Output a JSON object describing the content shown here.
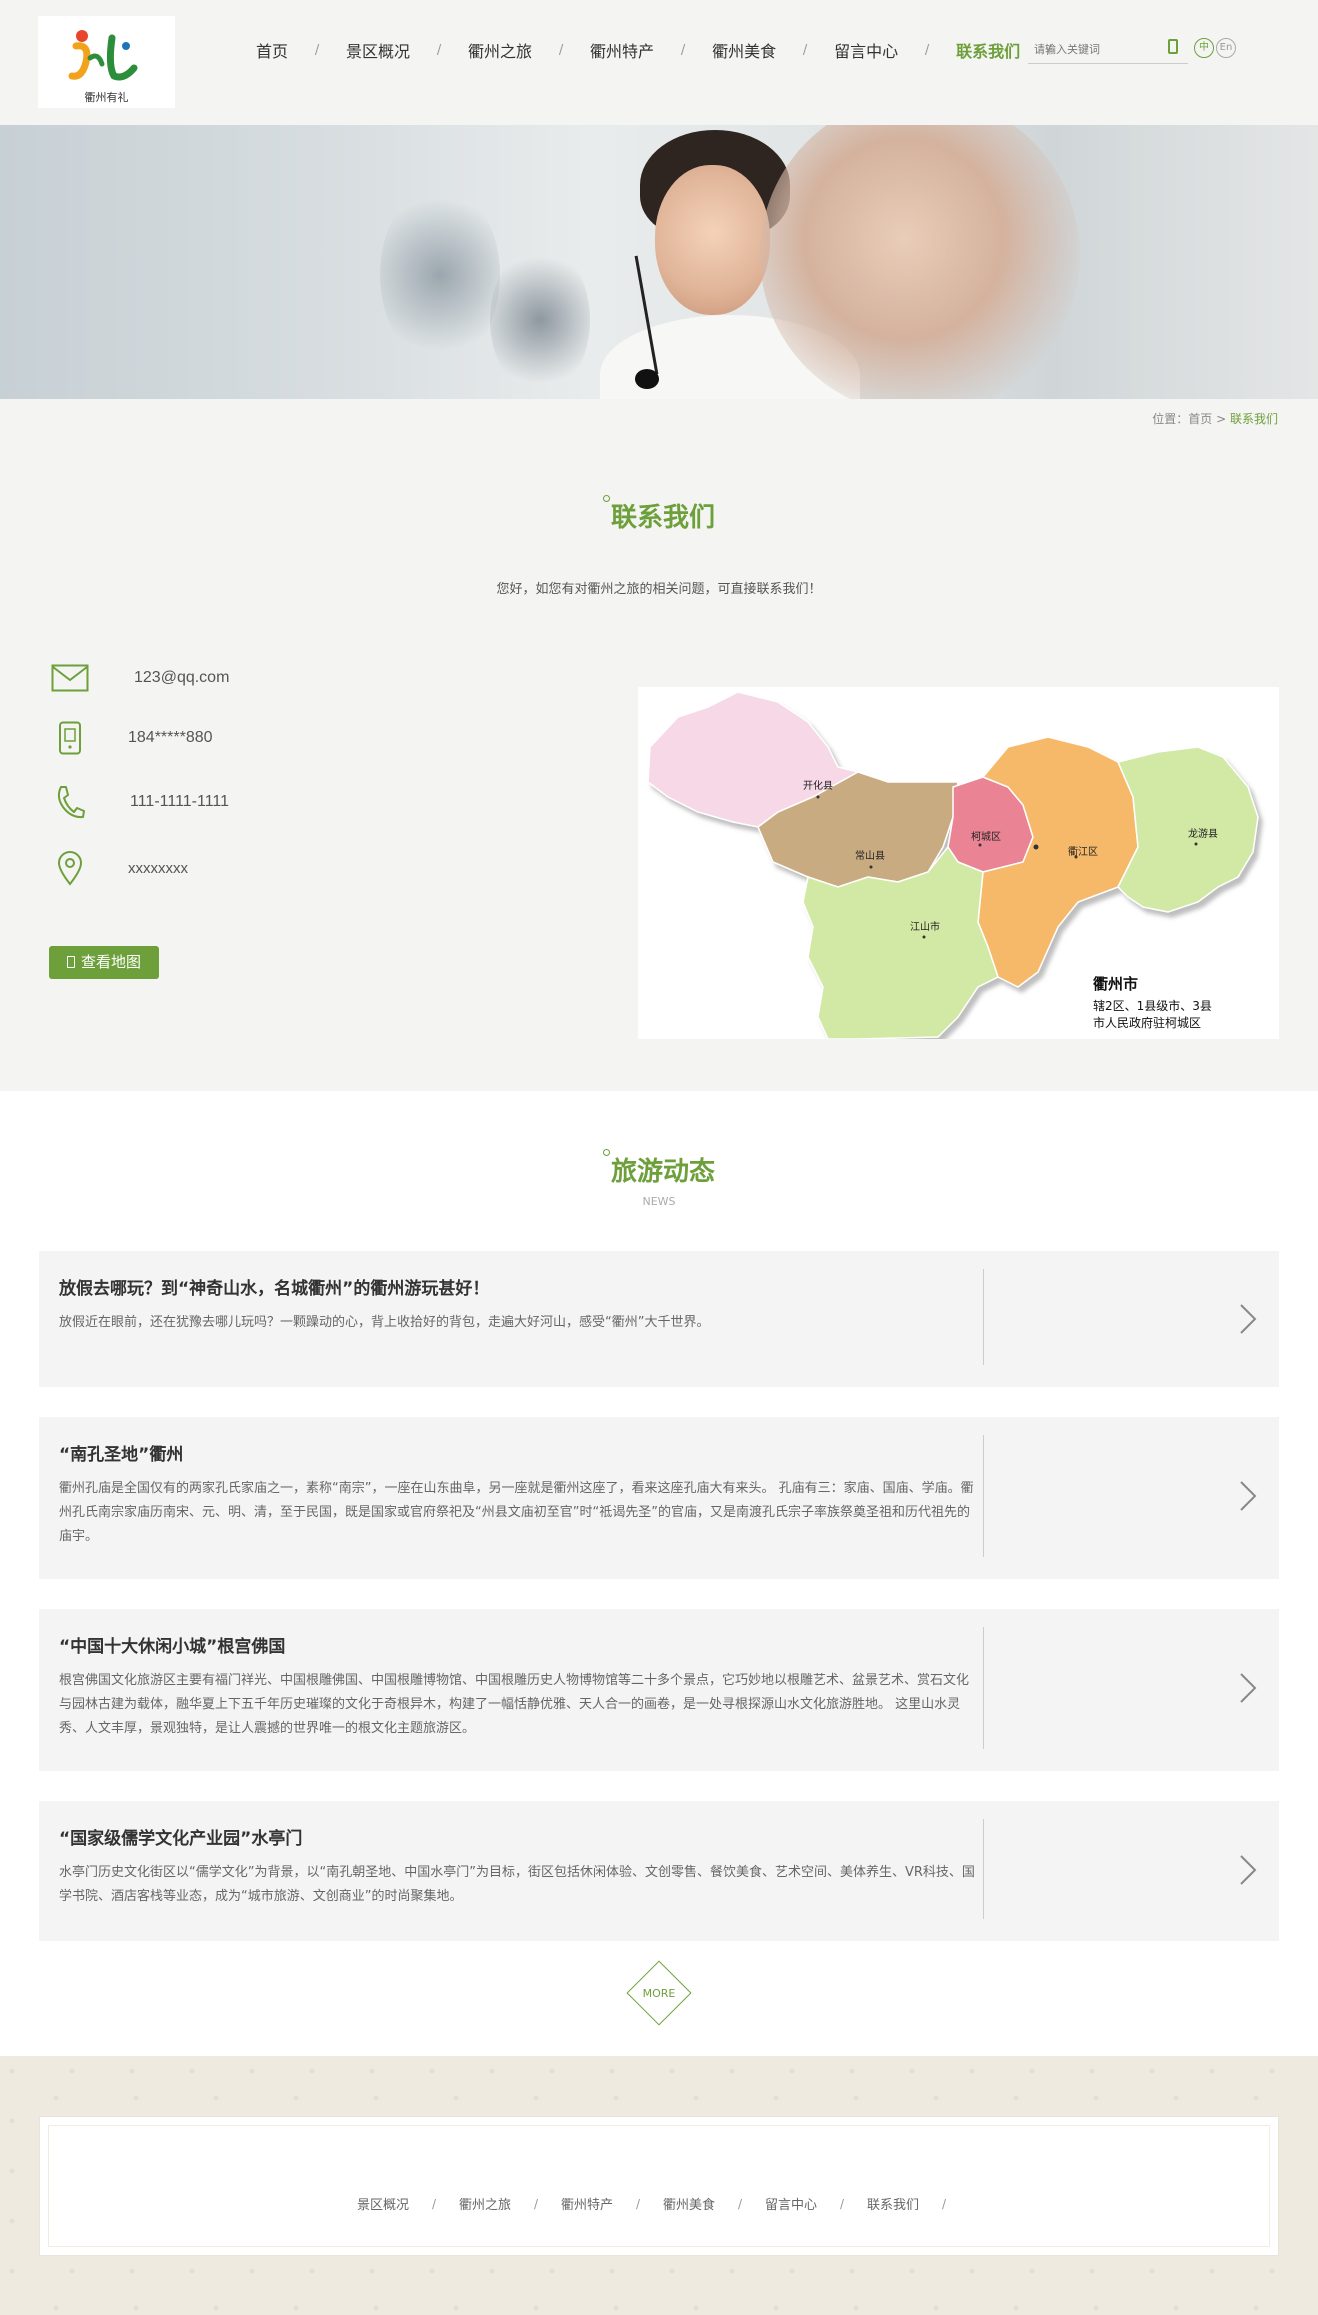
{
  "header": {
    "logo_text": "衢州有礼",
    "nav": [
      {
        "label": "首页"
      },
      {
        "label": "景区概况"
      },
      {
        "label": "衢州之旅"
      },
      {
        "label": "衢州特产"
      },
      {
        "label": "衢州美食"
      },
      {
        "label": "留言中心"
      },
      {
        "label": "联系我们",
        "active": true
      }
    ],
    "nav_separator": "/",
    "search_placeholder": "请输入关键词",
    "lang_zh": "中",
    "lang_en": "En"
  },
  "breadcrumb": {
    "prefix": "位置：首页",
    "sep": ">",
    "current": "联系我们"
  },
  "contact": {
    "title": "联系我们",
    "subtitle": "您好，如您有对衢州之旅的相关问题，可直接联系我们！",
    "email": "123@qq.com",
    "mobile": "184*****880",
    "phone": "111-1111-1111",
    "address": "xxxxxxxx",
    "map_button": "查看地图",
    "map": {
      "regions": [
        "开化县",
        "常山县",
        "柯城区",
        "衢江区",
        "龙游县",
        "江山市"
      ],
      "caption_title": "衢州市",
      "caption_line1": "辖2区、1县级市、3县",
      "caption_line2": "市人民政府驻柯城区"
    }
  },
  "news": {
    "title": "旅游动态",
    "subtitle": "NEWS",
    "items": [
      {
        "title": "放假去哪玩？到“神奇山水，名城衢州”的衢州游玩甚好！",
        "desc": "放假近在眼前，还在犹豫去哪儿玩吗？一颗躁动的心，背上收拾好的背包，走遍大好河山，感受“衢州”大千世界。"
      },
      {
        "title": "“南孔圣地”衢州",
        "desc": "衢州孔庙是全国仅有的两家孔氏家庙之一，素称“南宗”，一座在山东曲阜，另一座就是衢州这座了，看来这座孔庙大有来头。 孔庙有三：家庙、国庙、学庙。衢州孔氏南宗家庙历南宋、元、明、清，至于民国，既是国家或官府祭祀及“州县文庙初至官”时“祗谒先圣”的官庙，又是南渡孔氏宗子率族祭奠圣祖和历代祖先的庙宇。"
      },
      {
        "title": "“中国十大休闲小城”根宫佛国",
        "desc": "根宫佛国文化旅游区主要有福门祥光、中国根雕佛国、中国根雕博物馆、中国根雕历史人物博物馆等二十多个景点，它巧妙地以根雕艺术、盆景艺术、赏石文化与园林古建为载体，融华夏上下五千年历史璀璨的文化于奇根异木，构建了一幅恬静优雅、天人合一的画卷，是一处寻根探源山水文化旅游胜地。 这里山水灵秀、人文丰厚，景观独特，是让人震撼的世界唯一的根文化主题旅游区。"
      },
      {
        "title": "“国家级儒学文化产业园”水亭门",
        "desc": "水亭门历史文化街区以“儒学文化”为背景，以“南孔朝圣地、中国水亭门”为目标，街区包括休闲体验、文创零售、餐饮美食、艺术空间、美体养生、VR科技、国学书院、酒店客栈等业态，成为“城市旅游、文创商业”的时尚聚集地。"
      }
    ],
    "more_label": "MORE"
  },
  "footer": {
    "links": [
      {
        "label": "景区概况"
      },
      {
        "label": "衢州之旅"
      },
      {
        "label": "衢州特产"
      },
      {
        "label": "衢州美食"
      },
      {
        "label": "留言中心"
      },
      {
        "label": "联系我们"
      }
    ],
    "separator": "/"
  },
  "colors": {
    "accent": "#6da03b",
    "header_bg": "#f4f4f2",
    "footer_bg": "#efeadf"
  }
}
